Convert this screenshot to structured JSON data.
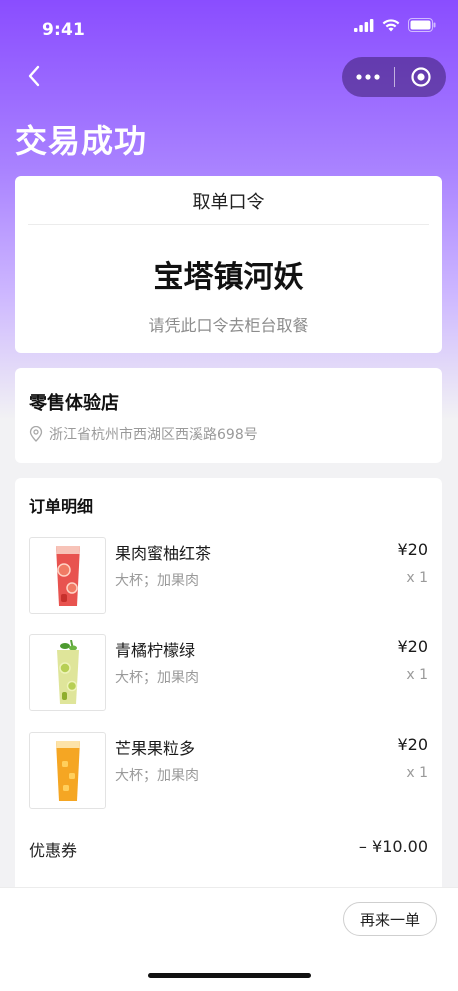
{
  "status_bar": {
    "time": "9:41"
  },
  "header": {
    "title": "交易成功"
  },
  "pickup": {
    "label": "取单口令",
    "code": "宝塔镇河妖",
    "hint": "请凭此口令去柜台取餐"
  },
  "store": {
    "name": "零售体验店",
    "address": "浙江省杭州市西湖区西溪路698号"
  },
  "order": {
    "title": "订单明细",
    "items": [
      {
        "name": "果肉蜜柚红茶",
        "spec": "大杯；加果肉",
        "price": "¥20",
        "qty": "x 1",
        "color": "#e8534f"
      },
      {
        "name": "青橘柠檬绿",
        "spec": "大杯；加果肉",
        "price": "¥20",
        "qty": "x 1",
        "color": "#c9d66a"
      },
      {
        "name": "芒果果粒多",
        "spec": "大杯；加果肉",
        "price": "¥20",
        "qty": "x 1",
        "color": "#f5a623"
      }
    ],
    "coupon": {
      "label": "优惠券",
      "value": "–  ¥10.00"
    }
  },
  "actions": {
    "reorder_label": "再来一单"
  },
  "colors": {
    "accent": "#8a4dff"
  }
}
